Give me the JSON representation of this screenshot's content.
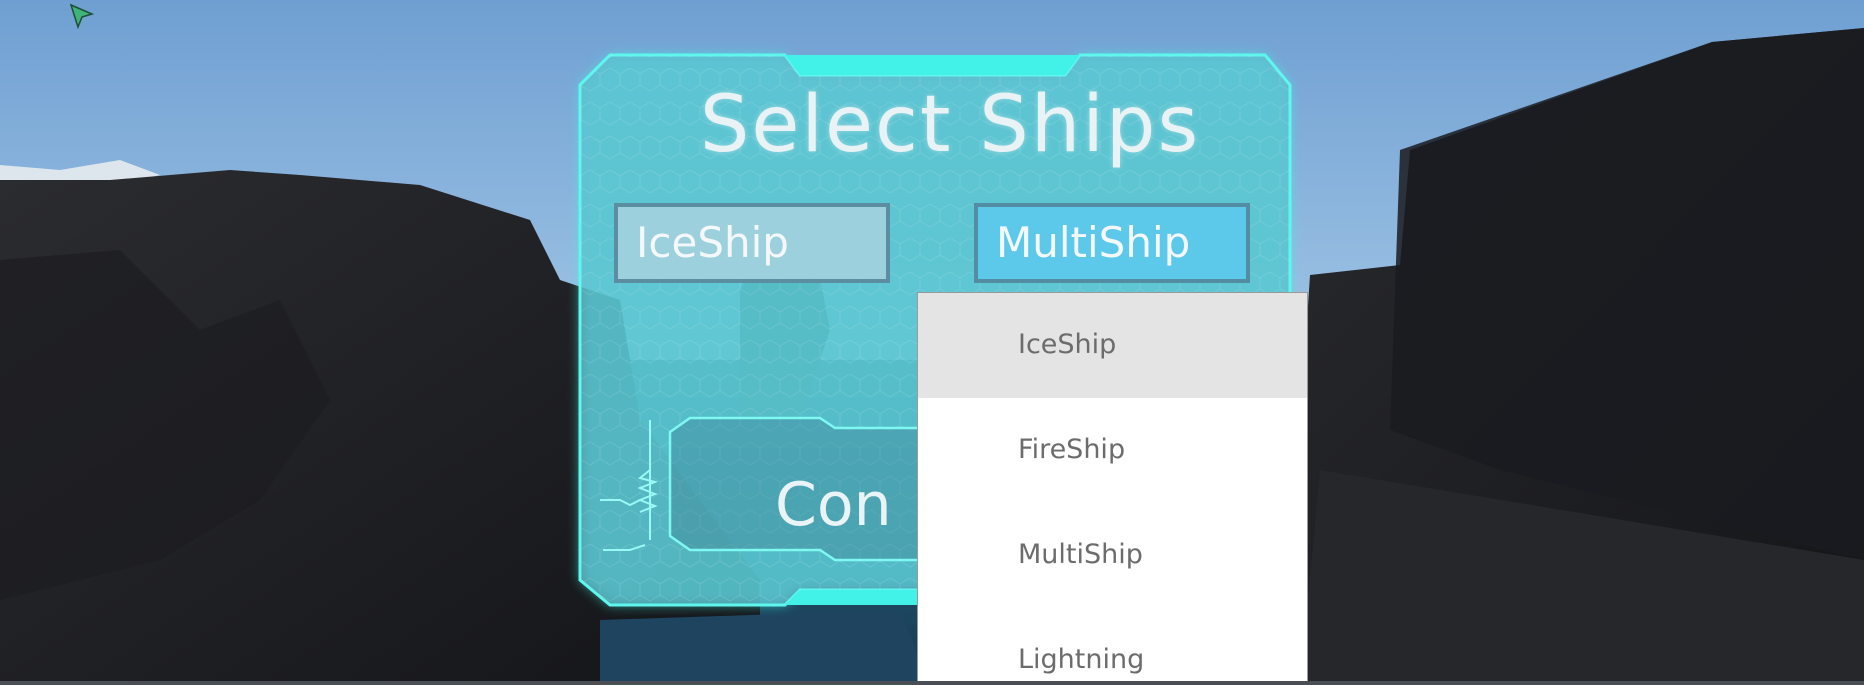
{
  "panel": {
    "title": "Select Ships",
    "left_select": "IceShip",
    "right_select": "MultiShip",
    "confirm_label": "Con"
  },
  "dropdown": {
    "items": [
      "IceShip",
      "FireShip",
      "MultiShip",
      "Lightning"
    ],
    "highlighted_index": 0
  },
  "colors": {
    "panel_glow": "#3ff0e6",
    "panel_fill": "#5fbccc",
    "selected_button": "#5cc8eb",
    "dropdown_bg": "#ffffff",
    "dropdown_highlight": "#e4e4e4"
  }
}
